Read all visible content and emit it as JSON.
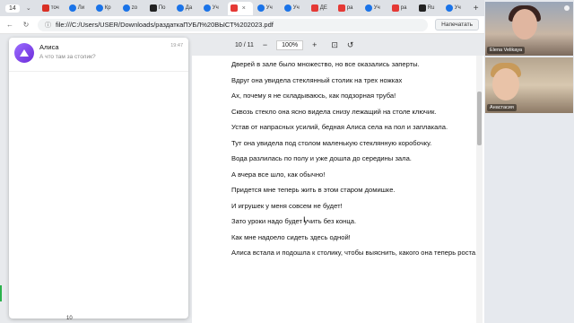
{
  "browser": {
    "tab_counter": "14",
    "tabs": [
      {
        "label": "точ",
        "icon": "red"
      },
      {
        "label": "Ли",
        "icon": "blue"
      },
      {
        "label": "Кр",
        "icon": "blue"
      },
      {
        "label": "zo",
        "icon": "blue"
      },
      {
        "label": "По",
        "icon": "dark"
      },
      {
        "label": "Да",
        "icon": "blue"
      },
      {
        "label": "Уч",
        "icon": "blue"
      },
      {
        "label": "",
        "icon": "pdf",
        "active": true
      },
      {
        "label": "Уч",
        "icon": "blue"
      },
      {
        "label": "Уч",
        "icon": "blue"
      },
      {
        "label": "ДЕ",
        "icon": "pdf"
      },
      {
        "label": "ра",
        "icon": "pdf"
      },
      {
        "label": "Уч",
        "icon": "blue"
      },
      {
        "label": "ра",
        "icon": "pdf"
      },
      {
        "label": "Ru",
        "icon": "dark"
      },
      {
        "label": "Уч",
        "icon": "blue"
      }
    ],
    "new_tab": "+",
    "address": "file:///C:/Users/USER/Downloads/раздаткаПУБЛ%20ВЫСТ%202023.pdf",
    "print_label": "Напечатать"
  },
  "pdf_toolbar": {
    "page_indicator": "10 / 11",
    "zoom": "100%"
  },
  "document": {
    "lines": [
      "Дверей в зале было множество, но все оказались заперты.",
      "Вдруг она увидела стеклянный столик на трех ножках",
      "Ах, почему я не складываюсь, как подзорная труба!",
      "Сквозь стекло она ясно видела снизу лежащий на столе ключик.",
      "Устав от напрасных усилий, бедная Алиса села на пол и заплакала.",
      "Тут она увидела под столом маленькую стеклянную коробочку.",
      "Вода разлилась по полу и уже дошла до середины зала.",
      "А вчера все шло, как обычно!",
      "Придется мне теперь жить в этом старом домишке.",
      "И игрушек у меня совсем не будет!",
      "Зато уроки надо будет учить без конца.",
      "Как мне надоело сидеть здесь одной!",
      "Алиса встала и подошла к столику, чтобы выяснить, какого она теперь роста."
    ]
  },
  "notification": {
    "name": "Алиса",
    "message": "А что там за столик?",
    "time": "19:47"
  },
  "page_number": "10",
  "video": {
    "participant1": "Elena Velikaya",
    "participant2": "Анастасия"
  }
}
